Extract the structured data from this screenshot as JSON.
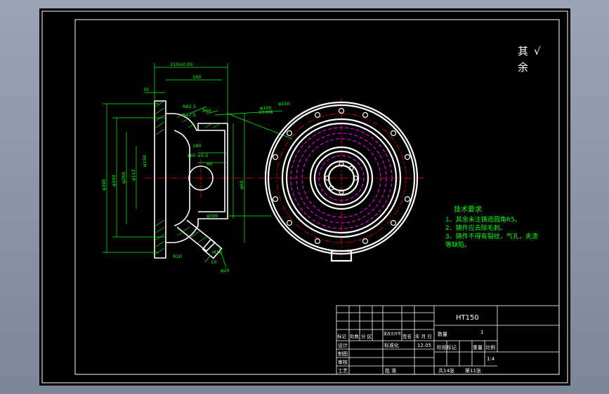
{
  "colors": {
    "background": "#8a94a6",
    "sheet": "#000000",
    "outline": "#ffffff",
    "dimension": "#00ff00",
    "centerline": "#ff0000",
    "hidden": "#ff00ff",
    "hatch": "#00ff00",
    "text": "#ffffff",
    "note": "#00ff00"
  },
  "surface_note": {
    "line1": "其",
    "line2": "余",
    "symbol": "√"
  },
  "technical_requirements": {
    "title": "技术要求",
    "items": [
      "1、其余未注铸造圆角R5。",
      "2、铸件应去除毛刺。",
      "3、铸件不得有裂纹，气孔，夹渣",
      "等缺陷。"
    ]
  },
  "section_view": {
    "dims": {
      "d1": "310±0.05",
      "d2": "160",
      "d3": "35",
      "d4": "R62.5",
      "d5": "R60",
      "d6": "φ47.5",
      "d7": "φ100",
      "d8": "φ150",
      "d9": "φ260",
      "d10": "φ112",
      "d11": "φ150",
      "d12": "φ340",
      "d13": "φ390",
      "d14": "180",
      "d15": "160 ±0.5",
      "d16": "80",
      "d17": "R10",
      "d18": "φ300",
      "d19": "φ20",
      "d20": "φ60",
      "d21": "M16",
      "d22": "10",
      "d23": "10-M8"
    }
  },
  "title_block": {
    "material": "HT150",
    "quantity_label": "数量",
    "quantity_value": "1",
    "row_labels": [
      "标记",
      "处数",
      "分 区",
      "更改文件号",
      "签名",
      "年 月 日"
    ],
    "design_label": "设计",
    "standard_label": "标准化",
    "date_value": "12.05",
    "draw_label": "制图",
    "review_label": "审核",
    "process_label": "工艺",
    "approve_label": "批 准",
    "stage_label": "阶段标记",
    "weight_label": "重量",
    "scale_label": "比例",
    "scale_value": "1:4",
    "sheets_total": "共14张",
    "sheet_no": "第11张"
  }
}
